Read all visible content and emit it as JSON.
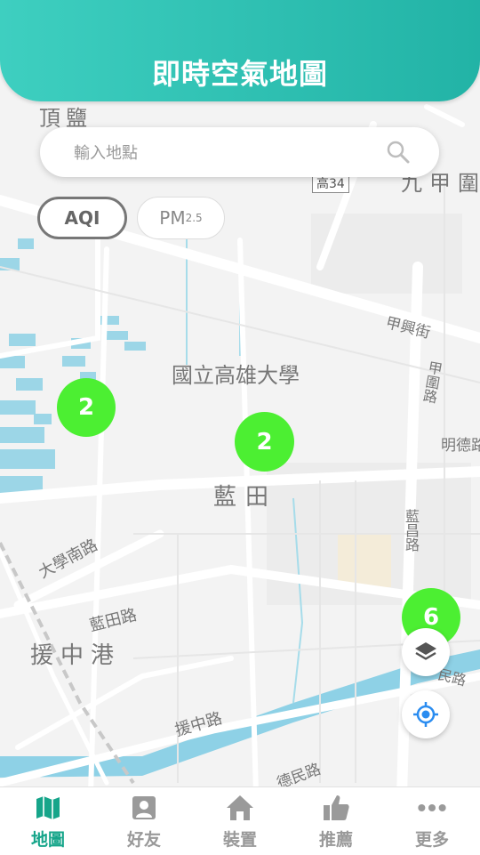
{
  "header": {
    "title": "即時空氣地圖"
  },
  "search": {
    "placeholder": "輸入地點"
  },
  "toggles": {
    "aqi": "AQI",
    "pm_main": "PM",
    "pm_sub": "2.5"
  },
  "map": {
    "place_labels": {
      "dingyan": "頂鹽",
      "jiujia": "九甲圍",
      "gao34": "高34",
      "jiaxing_st": "甲興街",
      "nuk": "國立高雄大學",
      "lantian": "藍田",
      "daxue_south_rd": "大學南路",
      "lantian_rd": "藍田路",
      "yuanzhonggang": "援中港",
      "yuanzhong_rd": "援中路",
      "demin_rd": "德民路",
      "mingde_rd": "明德路",
      "road_right_a": "甲圍路",
      "road_right_b": "藍昌路",
      "road_right_c": "民路"
    },
    "clusters": [
      {
        "count": "2"
      },
      {
        "count": "2"
      },
      {
        "count": "6"
      }
    ],
    "colors": {
      "cluster": "#4cef32",
      "marker": "#e53935",
      "water": "#8ed1e6"
    }
  },
  "tabs": [
    {
      "label": "地圖",
      "icon": "map-icon",
      "active": true
    },
    {
      "label": "好友",
      "icon": "friends-icon",
      "active": false
    },
    {
      "label": "裝置",
      "icon": "home-icon",
      "active": false
    },
    {
      "label": "推薦",
      "icon": "thumbs-up-icon",
      "active": false
    },
    {
      "label": "更多",
      "icon": "more-dots-icon",
      "active": false
    }
  ]
}
